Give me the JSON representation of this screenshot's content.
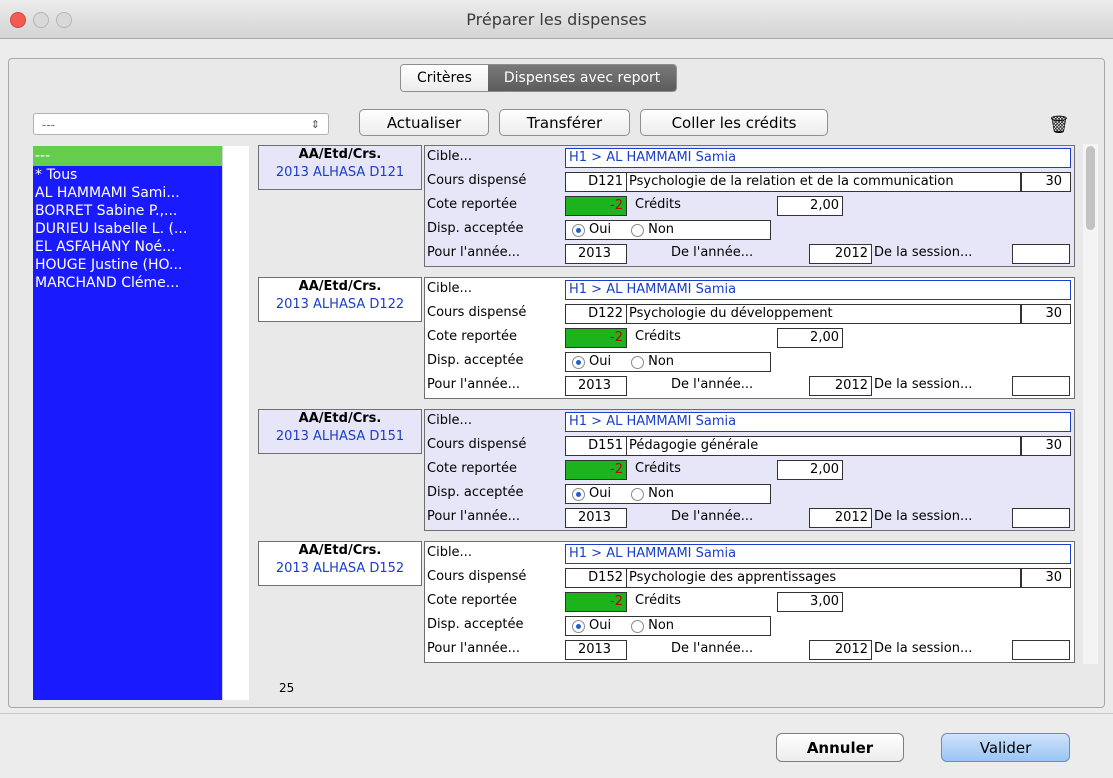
{
  "window": {
    "title": "Préparer les dispenses"
  },
  "tabs": [
    {
      "label": "Critères"
    },
    {
      "label": "Dispenses avec report"
    }
  ],
  "toolbar": {
    "select_value": "---",
    "actualiser": "Actualiser",
    "transferer": "Transférer",
    "coller": "Coller les crédits"
  },
  "list": {
    "items": [
      "---",
      "* Tous",
      "AL HAMMAMI Sami...",
      "BORRET Sabine P.,...",
      "DURIEU Isabelle L. (...",
      "EL ASFAHANY Noé...",
      "HOUGE Justine  (HO...",
      "MARCHAND Cléme..."
    ],
    "count": "25"
  },
  "labels": {
    "aa_header": "AA/Etd/Crs.",
    "cible": "Cible...",
    "cours": "Cours dispensé",
    "cote": "Cote reportée",
    "credits": "Crédits",
    "disp": "Disp. acceptée",
    "oui": "Oui",
    "non": "Non",
    "pour": "Pour l'année...",
    "de_annee": "De l'année...",
    "de_session": "De la session..."
  },
  "records": [
    {
      "id": "2013 ALHASA D121",
      "cible": "H1 > AL HAMMAMI Samia",
      "code": "D121",
      "course": "Psychologie de la relation et de la communication",
      "hours": "30",
      "cote": "-2",
      "credits": "2,00",
      "pour": "2013",
      "de": "2012",
      "session": ""
    },
    {
      "id": "2013 ALHASA D122",
      "cible": "H1 > AL HAMMAMI Samia",
      "code": "D122",
      "course": "Psychologie du développement",
      "hours": "30",
      "cote": "-2",
      "credits": "2,00",
      "pour": "2013",
      "de": "2012",
      "session": ""
    },
    {
      "id": "2013 ALHASA D151",
      "cible": "H1 > AL HAMMAMI Samia",
      "code": "D151",
      "course": "Pédagogie générale",
      "hours": "30",
      "cote": "-2",
      "credits": "2,00",
      "pour": "2013",
      "de": "2012",
      "session": ""
    },
    {
      "id": "2013 ALHASA D152",
      "cible": "H1 > AL HAMMAMI Samia",
      "code": "D152",
      "course": "Psychologie des apprentissages",
      "hours": "30",
      "cote": "-2",
      "credits": "3,00",
      "pour": "2013",
      "de": "2012",
      "session": ""
    }
  ],
  "footer": {
    "annuler": "Annuler",
    "valider": "Valider"
  },
  "colors": {
    "list_bg": "#1a1aff",
    "list_selected": "#66cc4d",
    "cote_bg": "#1db31d",
    "record_shaded": "#e6e6f8",
    "link_blue": "#1a3ec9"
  },
  "icons": {
    "trash": "trash-icon"
  }
}
